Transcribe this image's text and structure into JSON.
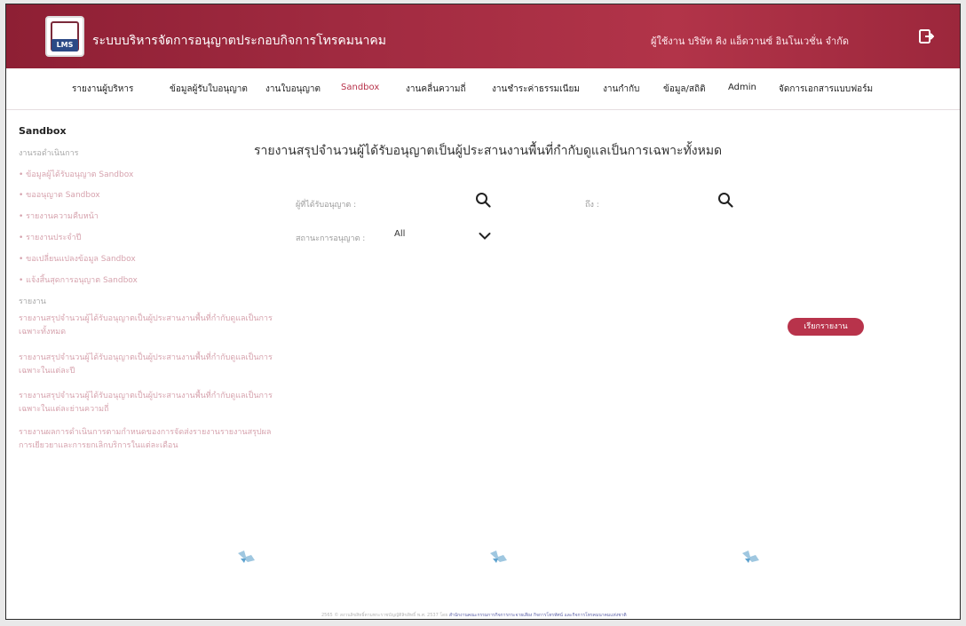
{
  "header": {
    "logo_top": "LMS",
    "logo_bottom": "LMS",
    "title": "ระบบบริหารจัดการอนุญาตประกอบกิจการโทรคมนาคม",
    "user": "ผู้ใช้งาน  บริษัท คิง แอ็ดวานซ์ อินโนเวชั่น จำกัด"
  },
  "nav": {
    "items": [
      "รายงานผู้บริหาร",
      "ข้อมูลผู้รับใบอนุญาต",
      "งานใบอนุญาต",
      "Sandbox",
      "งานคลื่นความถี่",
      "งานชำระค่าธรรมเนียม",
      "งานกำกับ",
      "ข้อมูล/สถิติ",
      "Admin",
      "จัดการเอกสารแบบฟอร์ม"
    ],
    "active": "Sandbox"
  },
  "sidebar": {
    "title": "Sandbox",
    "section1": "งานรอดำเนินการ",
    "links1": [
      "• ข้อมูลผู้ได้รับอนุญาต Sandbox",
      "• ขออนุญาต Sandbox",
      "• รายงานความคืบหน้า",
      "• รายงานประจำปี",
      "• ขอเปลี่ยนแปลงข้อมูล Sandbox",
      "• แจ้งสิ้นสุดการอนุญาต Sandbox"
    ],
    "section2": "รายงาน",
    "reports": [
      "รายงานสรุปจำนวนผู้ได้รับอนุญาตเป็นผู้ประสานงานพื้นที่กำกับดูแลเป็นการเฉพาะทั้งหมด",
      "รายงานสรุปจำนวนผู้ได้รับอนุญาตเป็นผู้ประสานงานพื้นที่กำกับดูแลเป็นการเฉพาะในแต่ละปี",
      "รายงานสรุปจำนวนผู้ได้รับอนุญาตเป็นผู้ประสานงานพื้นที่กำกับดูแลเป็นการเฉพาะในแต่ละย่านความถี่",
      "รายงานผลการดำเนินการตามกำหนดของการจัดส่งรายงานรายงานสรุปผลการเยียวยาและการยกเลิกบริการในแต่ละเดือน"
    ]
  },
  "main": {
    "title": "รายงานสรุปจำนวนผู้ได้รับอนุญาตเป็นผู้ประสานงานพื้นที่กำกับดูแลเป็นการเฉพาะทั้งหมด",
    "filter_licensee_label": "ผู้ที่ได้รับอนุญาต :",
    "filter_to_label": "ถึง :",
    "filter_status_label": "สถานะการอนุญาต :",
    "filter_status_value": "All",
    "report_button": "เรียกรายงาน"
  },
  "footer": {
    "text": "2565 © สงวนลิขสิทธิ์ตามพระราชบัญญัติลิขสิทธิ์ พ.ศ. 2537 โดย",
    "org": "สำนักงานคณะกรรมการกิจการกระจายเสียง กิจการโทรทัศน์ และกิจการโทรคมนาคมแห่งชาติ"
  }
}
